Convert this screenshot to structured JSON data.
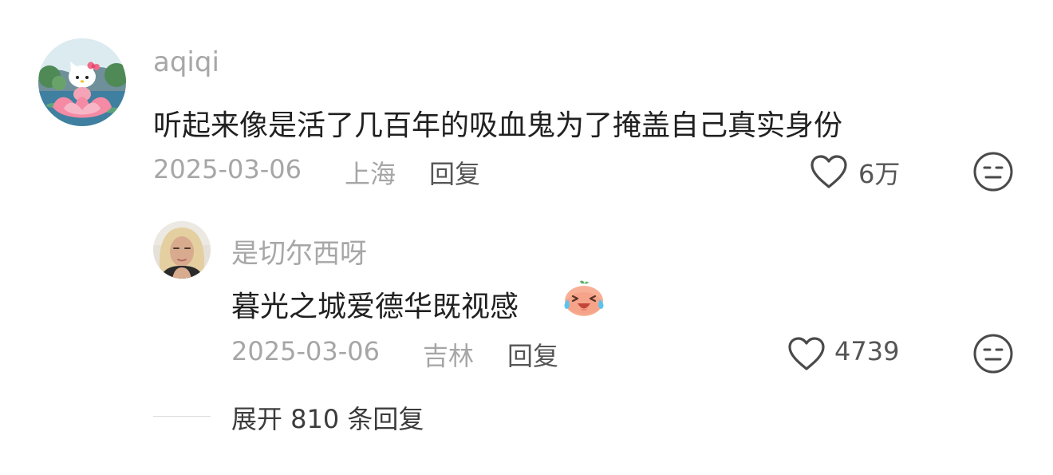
{
  "comment": {
    "username": "aqiqi",
    "text": "听起来像是活了几百年的吸血鬼为了掩盖自己真实身份",
    "date": "2025-03-06",
    "location": "上海",
    "reply_label": "回复",
    "likes": "6万"
  },
  "reply": {
    "username": "是切尔西呀",
    "text": "暮光之城爱德华既视感",
    "emoji": "crying-laughing-peach-emoji",
    "date": "2025-03-06",
    "location": "吉林",
    "reply_label": "回复",
    "likes": "4739"
  },
  "expand": {
    "label": "展开 810 条回复"
  },
  "icons": {
    "like": "heart-outline-icon",
    "dislike": "neutral-face-icon"
  },
  "colors": {
    "username": "#a7a7a7",
    "meta": "#a6a6a6",
    "text": "#202020",
    "action": "#555555"
  }
}
